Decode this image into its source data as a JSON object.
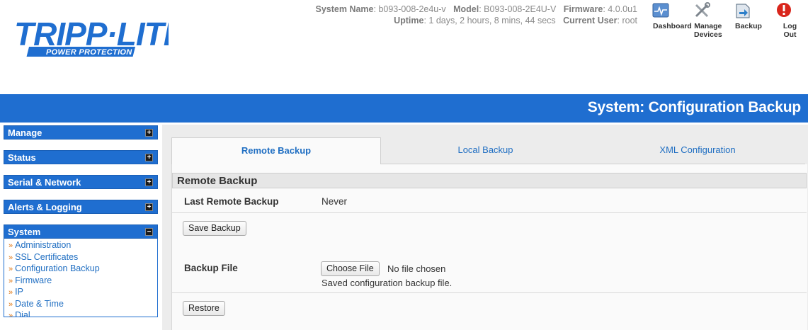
{
  "brand": {
    "name": "TRIPP·LITE",
    "tagline": "POWER PROTECTION",
    "color": "#1f6ed0"
  },
  "system": {
    "name_label": "System Name",
    "name_value": "b093-008-2e4u-v",
    "model_label": "Model",
    "model_value": "B093-008-2E4U-V",
    "firmware_label": "Firmware",
    "firmware_value": "4.0.0u1",
    "uptime_label": "Uptime",
    "uptime_value": "1 days, 2 hours, 8 mins, 44 secs",
    "user_label": "Current User",
    "user_value": "root"
  },
  "topnav": [
    {
      "label": "Dashboard",
      "icon": "dashboard-icon"
    },
    {
      "label": "Manage\nDevices",
      "icon": "tools-icon"
    },
    {
      "label": "Backup",
      "icon": "backup-icon"
    },
    {
      "label": "Log Out",
      "icon": "logout-icon"
    }
  ],
  "page_title": "System: Configuration Backup",
  "sidebar": {
    "groups": [
      {
        "label": "Manage",
        "toggle": "+"
      },
      {
        "label": "Status",
        "toggle": "+"
      },
      {
        "label": "Serial & Network",
        "toggle": "+"
      },
      {
        "label": "Alerts & Logging",
        "toggle": "+"
      },
      {
        "label": "System",
        "toggle": "−"
      }
    ],
    "system_items": [
      "Administration",
      "SSL Certificates",
      "Configuration Backup",
      "Firmware",
      "IP",
      "Date & Time",
      "Dial"
    ],
    "arrow": "»"
  },
  "tabs": [
    {
      "label": "Remote Backup",
      "active": true
    },
    {
      "label": "Local Backup",
      "active": false
    },
    {
      "label": "XML Configuration",
      "active": false
    }
  ],
  "remote": {
    "section_title": "Remote Backup",
    "last_label": "Last Remote Backup",
    "last_value": "Never",
    "save_button": "Save Backup",
    "file_label": "Backup File",
    "choose_button": "Choose File",
    "file_status": "No file chosen",
    "file_hint": "Saved configuration backup file.",
    "restore_button": "Restore"
  }
}
